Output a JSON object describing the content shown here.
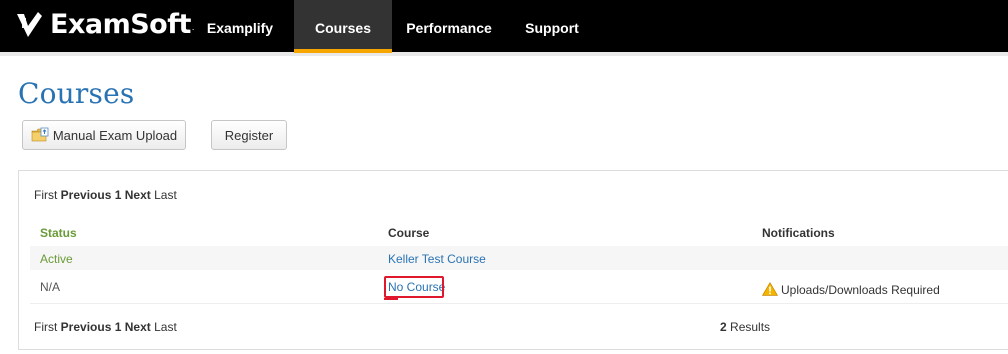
{
  "nav": {
    "logo_text": "ExamSoft",
    "logo_tm": ".",
    "tabs": [
      {
        "label": "Examplify",
        "active": false
      },
      {
        "label": "Courses",
        "active": true
      },
      {
        "label": "Performance",
        "active": false
      },
      {
        "label": "Support",
        "active": false
      }
    ]
  },
  "page": {
    "title": "Courses"
  },
  "toolbar": {
    "upload_label": "Manual Exam Upload",
    "register_label": "Register"
  },
  "pager": {
    "first": "First",
    "previous": "Previous",
    "page": "1",
    "next": "Next",
    "last": "Last"
  },
  "table": {
    "headers": {
      "status": "Status",
      "course": "Course",
      "notifications": "Notifications"
    },
    "rows": [
      {
        "status": "Active",
        "course": "Keller Test Course",
        "notification": ""
      },
      {
        "status": "N/A",
        "course": "No Course",
        "notification": "Uploads/Downloads Required"
      }
    ]
  },
  "results": {
    "count": "2",
    "label": "Results"
  },
  "colors": {
    "nav_bg": "#000000",
    "active_tab_bg": "#333333",
    "active_tab_accent": "#f7a600",
    "title_blue": "#2a73b3",
    "status_green": "#6a9b38",
    "highlight_red": "#e0182d",
    "warning_yellow": "#f5b400"
  },
  "icons": {
    "logo": "examsoft-check-mark-icon",
    "upload": "folder-upload-icon",
    "warning": "warning-triangle-icon"
  }
}
